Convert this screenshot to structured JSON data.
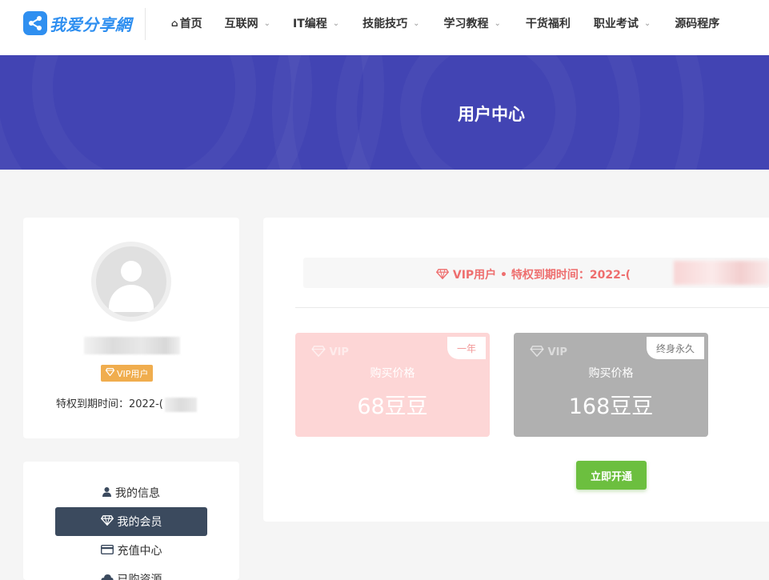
{
  "site": {
    "logo_text": "我爱分享網"
  },
  "nav": [
    {
      "label": "首页",
      "has_home_icon": true,
      "has_caret": false
    },
    {
      "label": "互联网",
      "has_caret": true
    },
    {
      "label": "IT编程",
      "has_caret": true
    },
    {
      "label": "技能技巧",
      "has_caret": true
    },
    {
      "label": "学习教程",
      "has_caret": true
    },
    {
      "label": "干货福利",
      "has_caret": false
    },
    {
      "label": "职业考试",
      "has_caret": true
    },
    {
      "label": "源码程序",
      "has_caret": false
    }
  ],
  "banner": {
    "title": "用户中心"
  },
  "profile": {
    "badge": "VIP用户",
    "expire_label": "特权到期时间：2022-("
  },
  "menu": [
    {
      "label": "我的信息",
      "icon": "user-icon",
      "active": false
    },
    {
      "label": "我的会员",
      "icon": "diamond-icon",
      "active": true
    },
    {
      "label": "充值中心",
      "icon": "credit-card-icon",
      "active": false
    },
    {
      "label": "已购资源",
      "icon": "cloud-icon",
      "active": false
    }
  ],
  "vip_status": {
    "text": "VIP用户 • 特权到期时间：2022-("
  },
  "plans": [
    {
      "watermark": "VIP",
      "tag": "一年",
      "label": "购买价格",
      "price": "68豆豆",
      "color": "#fdd6d6"
    },
    {
      "watermark": "VIP",
      "tag": "终身永久",
      "label": "购买价格",
      "price": "168豆豆",
      "color": "#b0b0b0"
    }
  ],
  "actions": {
    "open_label": "立即开通"
  },
  "colors": {
    "banner": "#4244b3",
    "accent": "#2f8ff0",
    "vip_badge": "#f0ad4e",
    "vip_text": "#ee6e6e",
    "menu_active": "#3b4a5e",
    "open_button": "#6cbf3f"
  }
}
